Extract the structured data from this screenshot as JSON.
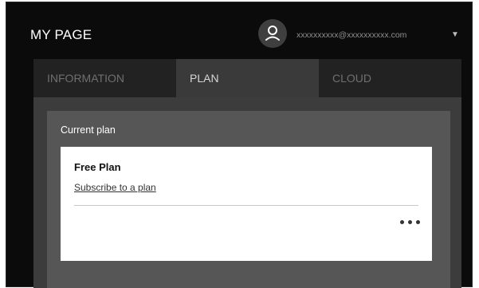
{
  "header": {
    "title": "MY PAGE",
    "account_email": "xxxxxxxxxx@xxxxxxxxxx.com",
    "avatar_icon": "user-icon",
    "dropdown_icon": "caret-down-icon",
    "caret_glyph": "▼"
  },
  "tabs": [
    {
      "label": "INFORMATION",
      "active": false
    },
    {
      "label": "PLAN",
      "active": true
    },
    {
      "label": "CLOUD",
      "active": false
    }
  ],
  "plan_section": {
    "label": "Current plan",
    "plan_name": "Free Plan",
    "subscribe_link": "Subscribe to a plan",
    "more_icon": "more-horizontal-icon"
  },
  "colors": {
    "background": "#0b0b0b",
    "tab_bar": "#222222",
    "active_tab": "#3a3a3a",
    "panel": "#565656",
    "card": "#ffffff"
  }
}
